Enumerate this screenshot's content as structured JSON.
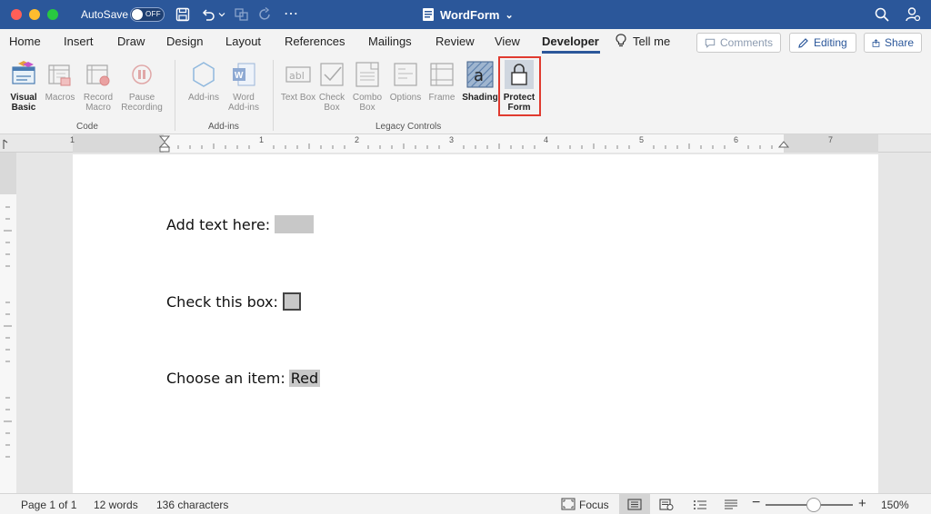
{
  "titlebar": {
    "autosave_label": "AutoSave",
    "toggle_text": "OFF",
    "doc_title": "WordForm",
    "more": "⋯",
    "caret": "⌄"
  },
  "tabs": [
    {
      "label": "Home"
    },
    {
      "label": "Insert"
    },
    {
      "label": "Draw"
    },
    {
      "label": "Design"
    },
    {
      "label": "Layout"
    },
    {
      "label": "References"
    },
    {
      "label": "Mailings"
    },
    {
      "label": "Review"
    },
    {
      "label": "View"
    },
    {
      "label": "Developer"
    },
    {
      "label": "Tell me"
    }
  ],
  "toolbar": {
    "comments": "Comments",
    "editing": "Editing",
    "share": "Share"
  },
  "ribbon": {
    "code": {
      "label": "Code",
      "visual_basic": "Visual Basic",
      "macros": "Macros",
      "record_macro": "Record Macro",
      "pause_recording": "Pause Recording"
    },
    "addins": {
      "label": "Add-ins",
      "add_ins": "Add-ins",
      "word_add_ins": "Word Add-ins"
    },
    "legacy": {
      "label": "Legacy Controls",
      "text_box": "Text Box",
      "check_box": "Check Box",
      "combo_box": "Combo Box",
      "options": "Options",
      "frame": "Frame",
      "shading": "Shading",
      "protect_form": "Protect Form"
    }
  },
  "ruler": {
    "numbers": [
      "1",
      "1",
      "2",
      "3",
      "4",
      "5",
      "6",
      "7"
    ]
  },
  "document": {
    "line1": "Add text here:",
    "line2": "Check this box:",
    "line3": "Choose an item:",
    "dropdown_value": "Red"
  },
  "status": {
    "page": "Page 1 of 1",
    "words": "12 words",
    "chars": "136 characters",
    "focus": "Focus",
    "zoom": "150%",
    "minus": "−",
    "plus": "+"
  },
  "colors": {
    "titlebar": "#2b579a",
    "highlight_border": "#e03a2f"
  }
}
